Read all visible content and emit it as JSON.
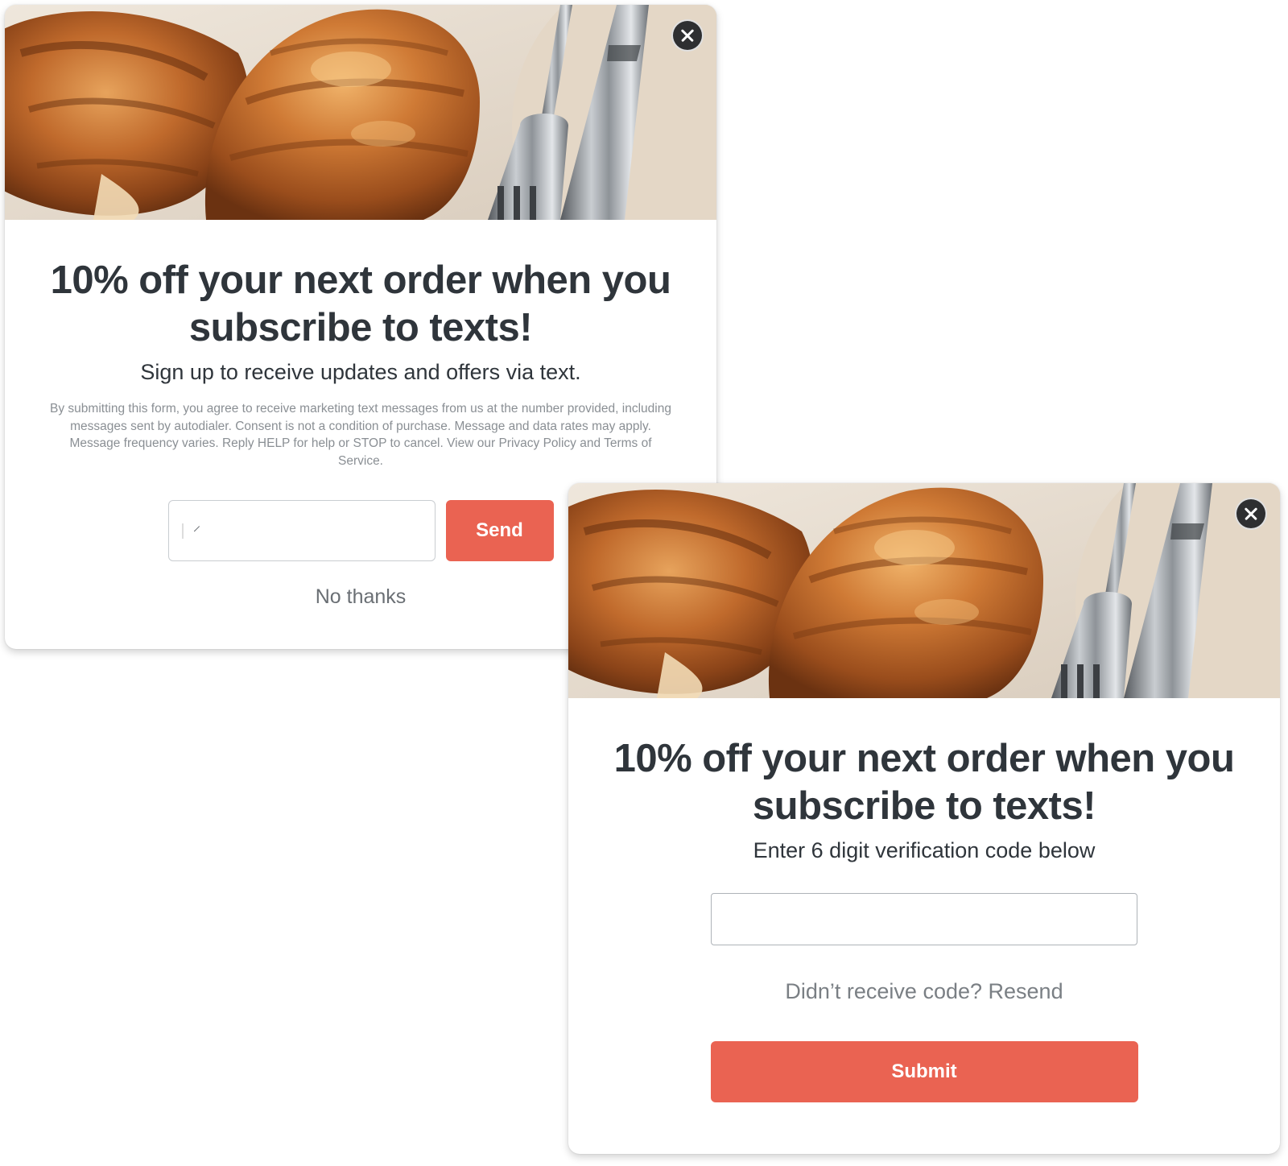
{
  "colors": {
    "accent": "#ea6352",
    "heading": "#2f353b",
    "muted": "#8a8f94",
    "close_button_bg": "#2e2f31"
  },
  "popup_signup": {
    "close_icon": "close-icon",
    "hero_image": "croissants-with-fork-and-knife",
    "headline": "10% off your next order when you subscribe to texts!",
    "subhead": "Sign up to receive updates and offers via text.",
    "disclaimer": "By submitting this form, you agree to receive marketing text messages from us at the number provided, including messages sent by autodialer. Consent is not a condition of purchase. Message and data rates may apply. Message frequency varies. Reply HELP for help or STOP to cancel. View our Privacy Policy and Terms of Service.",
    "phone_field": {
      "country_flag": "us-flag-icon",
      "value": "",
      "placeholder": ""
    },
    "send_label": "Send",
    "no_thanks_label": "No thanks"
  },
  "popup_verify": {
    "close_icon": "close-icon",
    "hero_image": "croissants-with-fork-and-knife",
    "headline": "10% off your next order when you subscribe to texts!",
    "subhead": "Enter 6 digit verification code below",
    "code_field": {
      "value": "",
      "placeholder": ""
    },
    "resend_prompt": "Didn’t receive code?",
    "resend_label": "Resend",
    "submit_label": "Submit"
  }
}
